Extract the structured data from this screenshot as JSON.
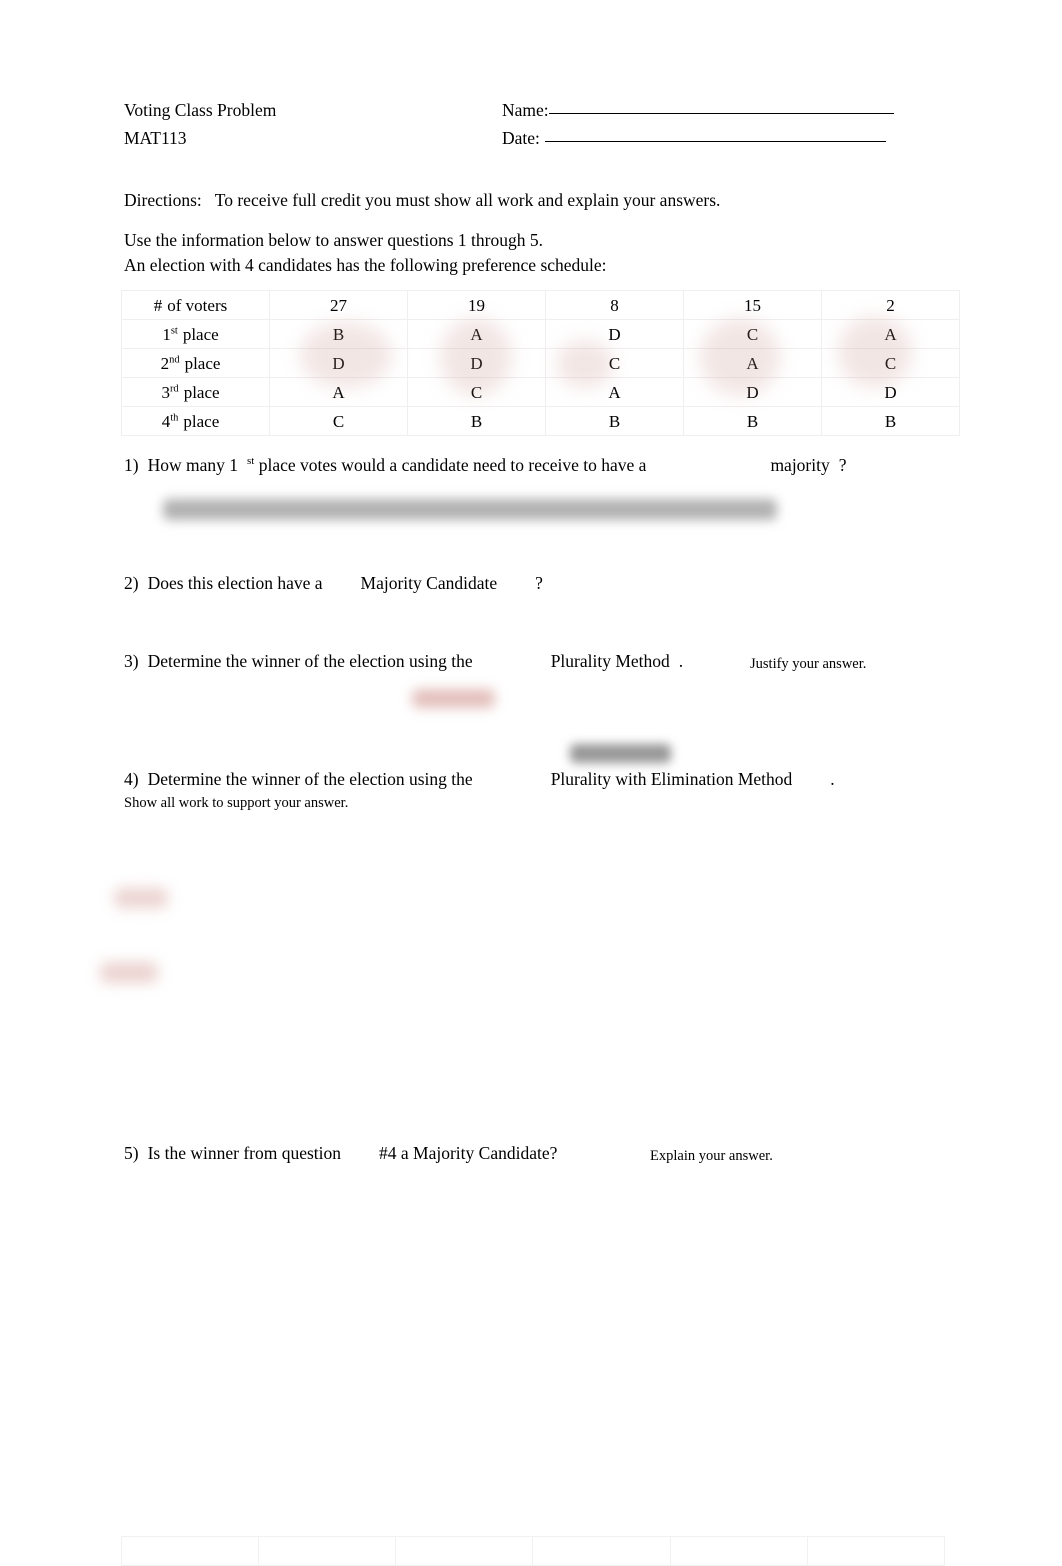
{
  "document": {
    "header": {
      "title": "Voting Class Problem",
      "course": "MAT113",
      "name_label": "Name:",
      "date_label": "Date:"
    },
    "directions": {
      "label": "Directions:",
      "text": "To receive full credit you must show all work and explain your answers."
    },
    "intro": {
      "line1": "Use the information below to answer questions 1 through 5.",
      "line2": "An election with 4 candidates has the following preference schedule:"
    },
    "preference_table": {
      "row_labels": [
        "# of voters",
        "1st place",
        "2nd place",
        "3rd place",
        "4th place"
      ],
      "row_label_parts": [
        {
          "num": "#",
          "sup": "",
          "word": "of voters"
        },
        {
          "num": "1",
          "sup": "st",
          "word": "place"
        },
        {
          "num": "2",
          "sup": "nd",
          "word": "place"
        },
        {
          "num": "3",
          "sup": "rd",
          "word": "place"
        },
        {
          "num": "4",
          "sup": "th",
          "word": "place"
        }
      ],
      "voters": [
        "27",
        "19",
        "8",
        "15",
        "2"
      ],
      "rows": [
        [
          "B",
          "A",
          "D",
          "C",
          "A"
        ],
        [
          "D",
          "D",
          "C",
          "A",
          "C"
        ],
        [
          "A",
          "C",
          "A",
          "D",
          "D"
        ],
        [
          "C",
          "B",
          "B",
          "B",
          "B"
        ]
      ]
    },
    "questions": [
      {
        "number": "1)",
        "part_a": "How many 1",
        "superscript": "st",
        "part_b": "place votes would a candidate need to receive to have a",
        "emphasis": "majority",
        "part_c": "?"
      },
      {
        "number": "2)",
        "part_a": "Does this election have a",
        "emphasis": "Majority Candidate",
        "part_c": "?"
      },
      {
        "number": "3)",
        "part_a": "Determine the winner of the election using the",
        "emphasis": "Plurality Method",
        "part_c": ".",
        "note": "Justify your answer."
      },
      {
        "number": "4)",
        "part_a": "Determine the winner of the election using the",
        "emphasis": "Plurality with Elimination Method",
        "part_c": ".",
        "note": "Show all work to support your answer."
      },
      {
        "number": "5)",
        "part_a": "Is the winner from question",
        "emphasis": "#4  a Majority Candidate?",
        "note": "Explain your answer."
      }
    ],
    "colors": {
      "text": "#000000",
      "page_background": "#ffffff",
      "table_border": "#f0eeee",
      "annotation_red": "#ba6056",
      "annotation_gray": "#464646"
    }
  }
}
